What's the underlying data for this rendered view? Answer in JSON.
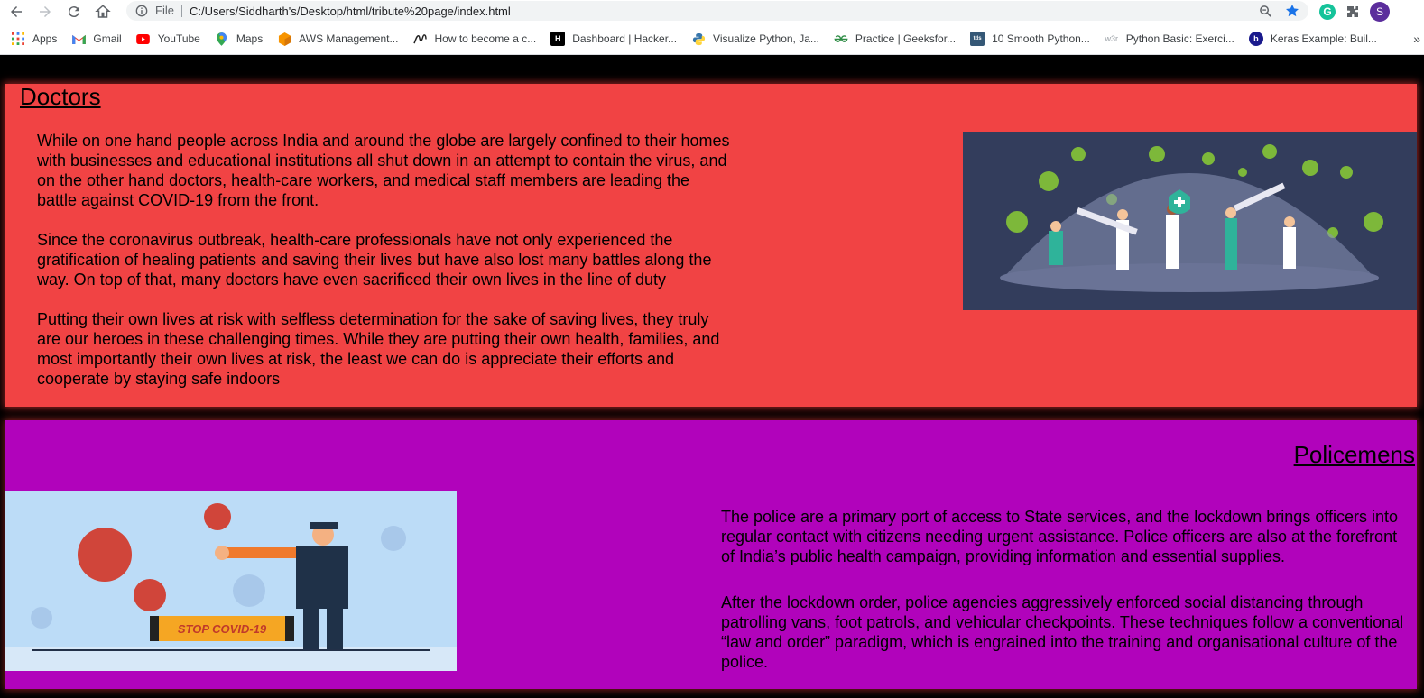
{
  "browser": {
    "file_chip": "File",
    "url": "C:/Users/Siddharth's/Desktop/html/tribute%20page/index.html",
    "avatar_letter": "S",
    "ext_letter": "G",
    "bookmarks": [
      {
        "label": "Apps",
        "icon": "apps-grid-icon"
      },
      {
        "label": "Gmail",
        "icon": "gmail-icon"
      },
      {
        "label": "YouTube",
        "icon": "youtube-icon"
      },
      {
        "label": "Maps",
        "icon": "maps-icon"
      },
      {
        "label": "AWS Management...",
        "icon": "aws-icon"
      },
      {
        "label": "How to become a c...",
        "icon": "medium-icon"
      },
      {
        "label": "Dashboard | Hacker...",
        "icon": "hackerrank-icon"
      },
      {
        "label": "Visualize Python, Ja...",
        "icon": "python-icon"
      },
      {
        "label": "Practice | Geeksfor...",
        "icon": "geeksforgeeks-icon"
      },
      {
        "label": "10 Smooth Python...",
        "icon": "tds-icon"
      },
      {
        "label": "Python Basic: Exerci...",
        "icon": "w3r-icon"
      },
      {
        "label": "Keras Example: Buil...",
        "icon": "b-icon"
      }
    ],
    "bookmark_badges": {
      "hackerrank": "H",
      "tds": "tds",
      "w3r": "w3r",
      "b": "b"
    }
  },
  "doctors": {
    "heading": "Doctors",
    "paragraphs": [
      "While on one hand people across India and around the globe are largely confined to their homes with businesses and educational institutions all shut down in an attempt to contain the virus, and on the other hand doctors, health-care workers, and medical staff members are leading the battle against COVID-19 from the front.",
      "Since the coronavirus outbreak, health-care professionals have not only experienced the gratification of healing patients and saving their lives but have also lost many battles along the way. On top of that, many doctors have even sacrificed their own lives in the line of duty",
      "Putting their own lives at risk with selfless determination for the sake of saving lives, they truly are our heroes in these challenging times. While they are putting their own health, families, and most importantly their own lives at risk, the least we can do is appreciate their efforts and cooperate by staying safe indoors"
    ]
  },
  "police": {
    "heading": "Policemens",
    "paragraphs": [
      "The police are a primary port of access to State services, and the lockdown brings officers into regular contact with citizens needing urgent assistance. Police officers are also at the forefront of India’s public health campaign, providing information and essential supplies.",
      "After the lockdown order, police agencies aggressively enforced social distancing through patrolling vans, foot patrols, and vehicular checkpoints. These techniques follow a conventional “law and order” paradigm, which is engrained into the training and organisational culture of the police."
    ],
    "image_sign_text": "STOP COVID-19"
  },
  "colors": {
    "doctors_bg": "#f14344",
    "police_bg": "#b103bb",
    "page_bg": "#000000"
  }
}
